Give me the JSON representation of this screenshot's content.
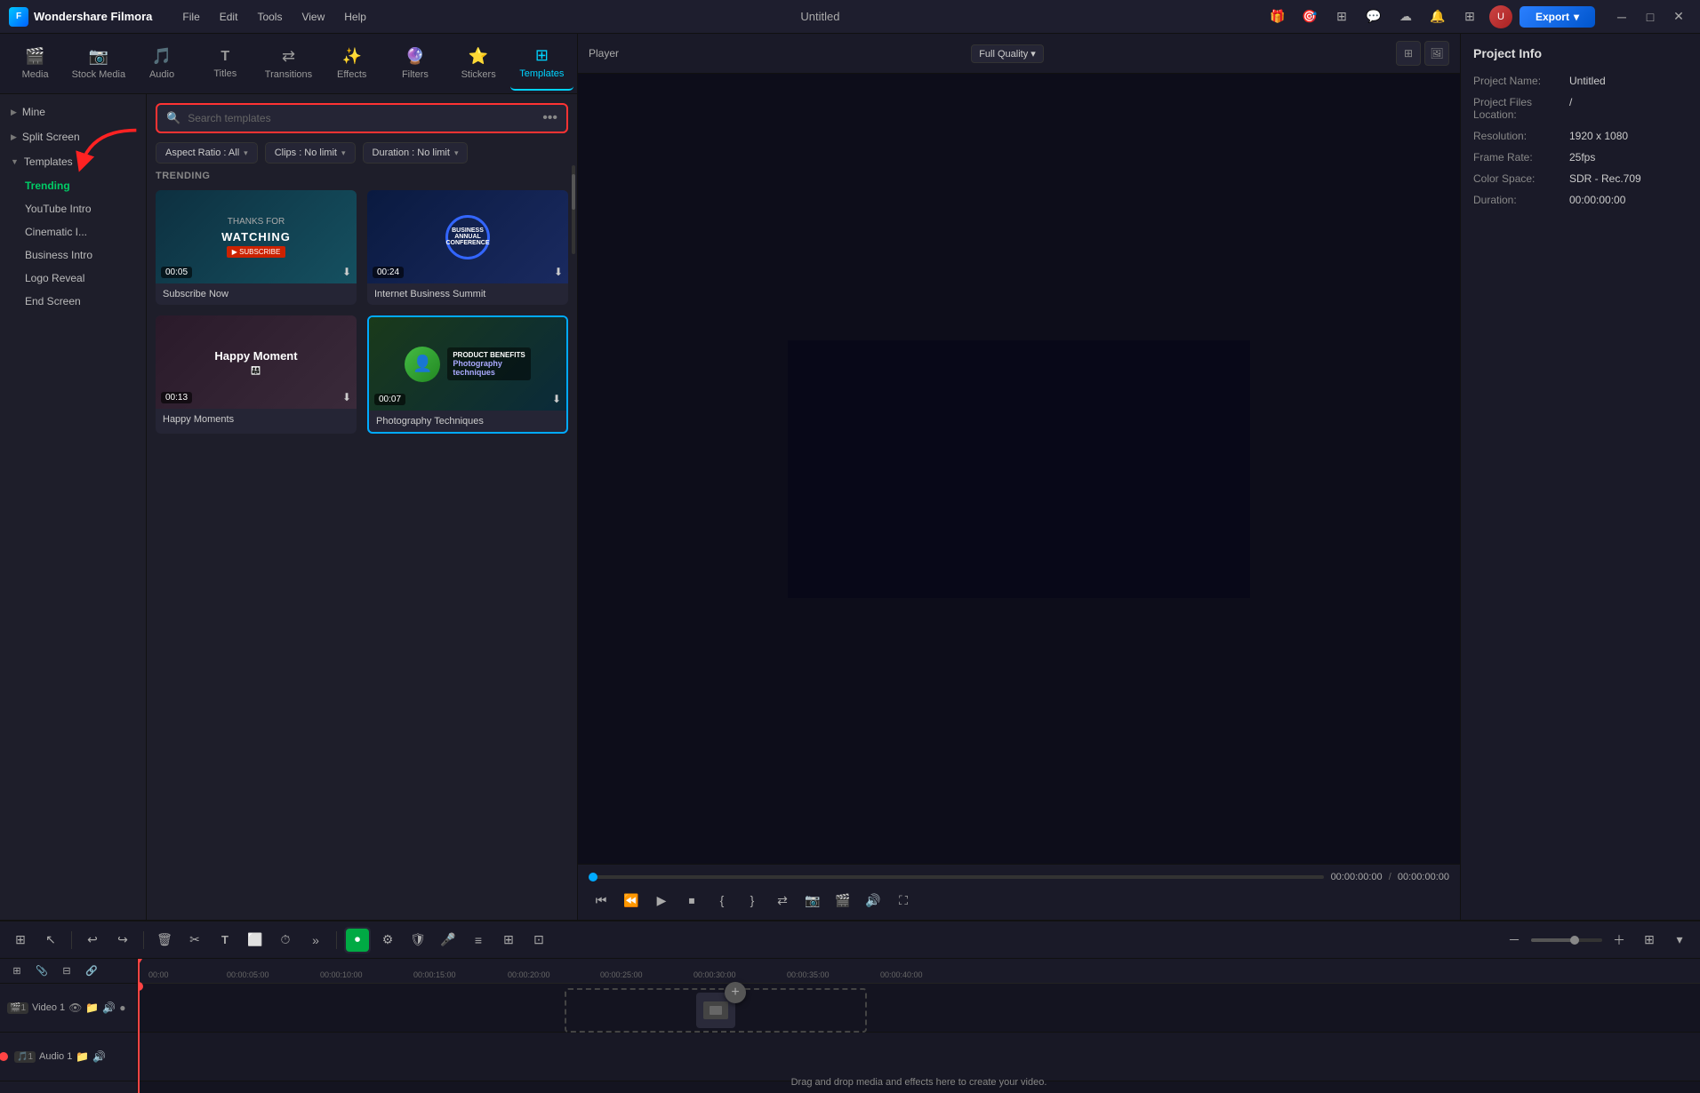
{
  "app": {
    "name": "Wondershare Filmora",
    "title": "Untitled",
    "logo_text": "F"
  },
  "titlebar": {
    "menu_items": [
      "File",
      "Edit",
      "Tools",
      "View",
      "Help"
    ],
    "export_label": "Export"
  },
  "toolbar": {
    "tabs": [
      {
        "id": "media",
        "label": "Media",
        "icon": "🎬"
      },
      {
        "id": "stock_media",
        "label": "Stock Media",
        "icon": "📷"
      },
      {
        "id": "audio",
        "label": "Audio",
        "icon": "🎵"
      },
      {
        "id": "titles",
        "label": "Titles",
        "icon": "T"
      },
      {
        "id": "transitions",
        "label": "Transitions",
        "icon": "➡"
      },
      {
        "id": "effects",
        "label": "Effects",
        "icon": "✨"
      },
      {
        "id": "filters",
        "label": "Filters",
        "icon": "🔮"
      },
      {
        "id": "stickers",
        "label": "Stickers",
        "icon": "⭐"
      },
      {
        "id": "templates",
        "label": "Templates",
        "icon": "⊞"
      }
    ]
  },
  "sidebar": {
    "items": [
      {
        "id": "mine",
        "label": "Mine",
        "type": "group",
        "expanded": false
      },
      {
        "id": "split_screen",
        "label": "Split Screen",
        "type": "group",
        "expanded": false
      },
      {
        "id": "templates",
        "label": "Templates",
        "type": "group",
        "expanded": true,
        "children": [
          {
            "id": "trending",
            "label": "Trending",
            "active": true
          },
          {
            "id": "youtube_intro",
            "label": "YouTube Intro"
          },
          {
            "id": "cinematic_i",
            "label": "Cinematic I..."
          },
          {
            "id": "business_intro",
            "label": "Business Intro"
          },
          {
            "id": "logo_reveal",
            "label": "Logo Reveal"
          },
          {
            "id": "end_screen",
            "label": "End Screen"
          }
        ]
      }
    ]
  },
  "template_panel": {
    "search_placeholder": "Search templates",
    "filters": {
      "aspect_ratio": "Aspect Ratio : All",
      "clips": "Clips : No limit",
      "duration": "Duration : No limit"
    },
    "section_label": "TRENDING",
    "templates": [
      {
        "id": "subscribe_now",
        "title": "Subscribe Now",
        "duration": "00:05",
        "thumb_type": "subscribe"
      },
      {
        "id": "internet_business_summit",
        "title": "Internet Business Summit",
        "duration": "00:24",
        "thumb_type": "business"
      },
      {
        "id": "happy_moments",
        "title": "Happy Moments",
        "duration": "00:13",
        "thumb_type": "moments"
      },
      {
        "id": "photography_techniques",
        "title": "Photography Techniques",
        "duration": "00:07",
        "thumb_type": "photo_tech"
      }
    ]
  },
  "player": {
    "label": "Player",
    "quality": "Full Quality",
    "current_time": "00:00:00:00",
    "total_time": "00:00:00:00"
  },
  "project_info": {
    "panel_title": "Project Info",
    "fields": [
      {
        "label": "Project Name:",
        "value": "Untitled"
      },
      {
        "label": "Project Files Location:",
        "value": "/"
      },
      {
        "label": "Resolution:",
        "value": "1920 x 1080"
      },
      {
        "label": "Frame Rate:",
        "value": "25fps"
      },
      {
        "label": "Color Space:",
        "value": "SDR - Rec.709"
      },
      {
        "label": "Duration:",
        "value": "00:00:00:00"
      }
    ]
  },
  "timeline": {
    "tracks": [
      {
        "id": "video_1",
        "label": "Video 1",
        "icon": "🎬"
      },
      {
        "id": "audio_1",
        "label": "Audio 1",
        "icon": "🎵"
      }
    ],
    "ruler_marks": [
      "00:00",
      "00:00:05:00",
      "00:00:10:00",
      "00:00:15:00",
      "00:00:20:00",
      "00:00:25:00",
      "00:00:30:00",
      "00:00:35:00",
      "00:00:40:00"
    ],
    "drag_drop_hint": "Drag and drop media and effects here to create your video."
  }
}
